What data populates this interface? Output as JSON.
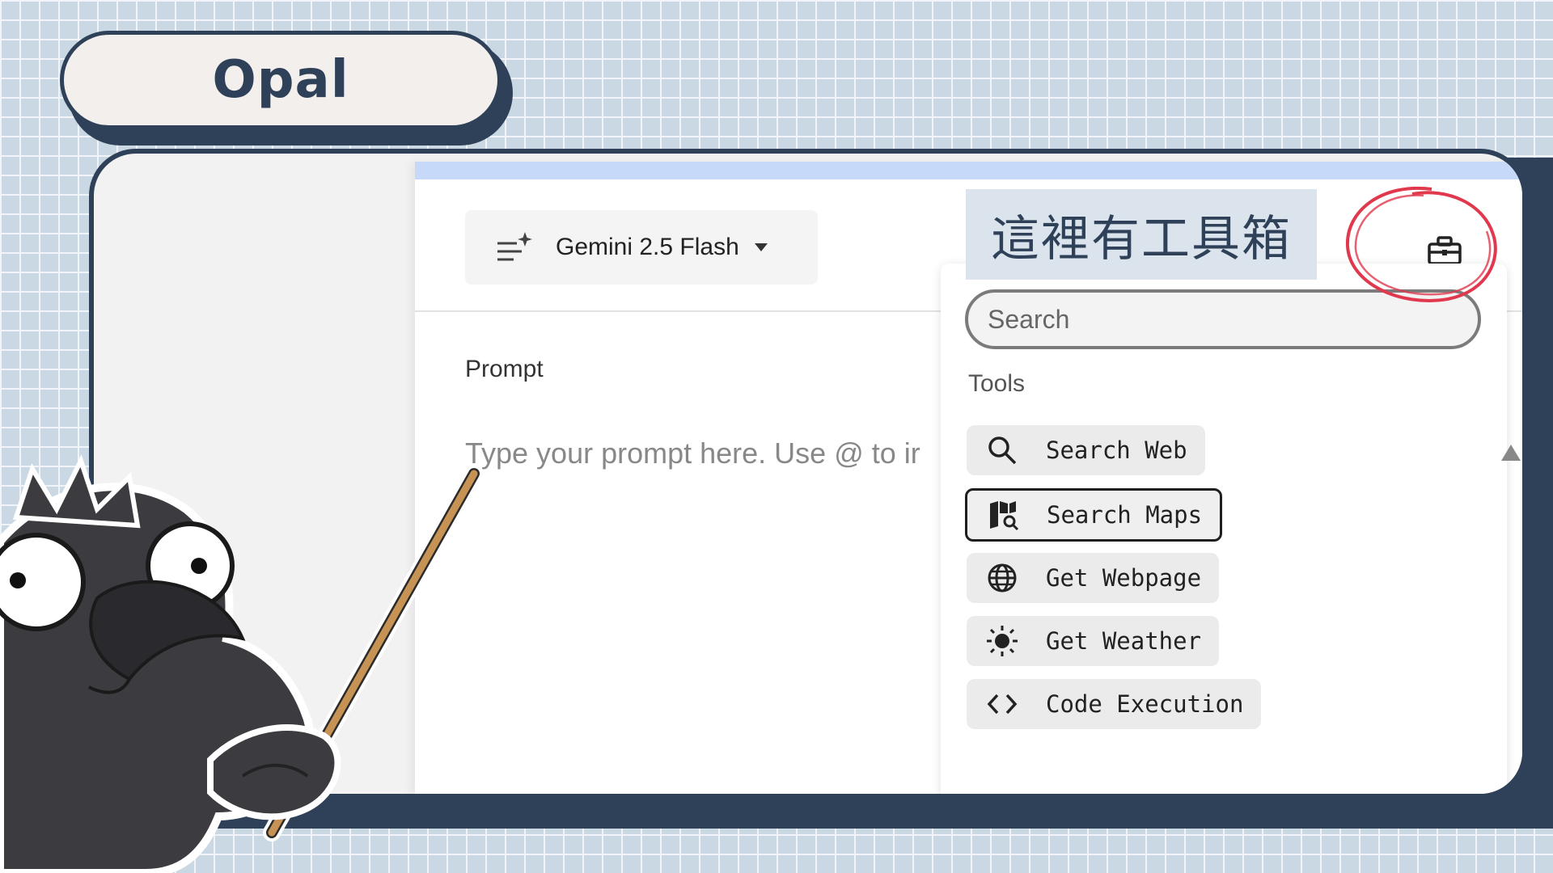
{
  "slide": {
    "title": "Opal"
  },
  "model_selector": {
    "label": "Gemini 2.5 Flash",
    "icon": "sparkle-list-icon"
  },
  "prompt": {
    "label": "Prompt",
    "placeholder": "Type your prompt here. Use @ to ir"
  },
  "toolbox": {
    "icon": "toolbox-icon"
  },
  "dropdown": {
    "search_placeholder": "Search",
    "section_title": "Tools",
    "tools": [
      {
        "label": "Search Web",
        "icon": "search-icon"
      },
      {
        "label": "Search Maps",
        "icon": "map-search-icon",
        "selected": true
      },
      {
        "label": "Get Webpage",
        "icon": "globe-icon"
      },
      {
        "label": "Get Weather",
        "icon": "sun-icon"
      },
      {
        "label": "Code Execution",
        "icon": "code-icon"
      }
    ]
  },
  "annotation": {
    "text": "這裡有工具箱",
    "circle_color": "#e0394e"
  },
  "colors": {
    "navy": "#2f4159",
    "accent_bar": "#c6d9f8",
    "grid_background": "#cad8e4"
  }
}
